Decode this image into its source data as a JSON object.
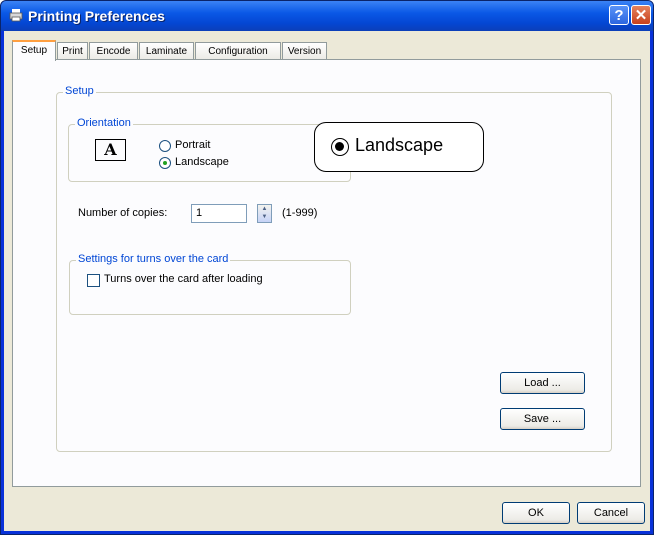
{
  "window": {
    "title": "Printing Preferences",
    "help_symbol": "?",
    "close_symbol": "✕"
  },
  "tabs": [
    {
      "label": "Setup",
      "active": true
    },
    {
      "label": "Print"
    },
    {
      "label": "Encode"
    },
    {
      "label": "Laminate"
    },
    {
      "label": "Configuration"
    },
    {
      "label": "Version"
    }
  ],
  "setup": {
    "group_label": "Setup",
    "orientation": {
      "group_label": "Orientation",
      "icon_glyph": "A",
      "portrait_label": "Portrait",
      "landscape_label": "Landscape",
      "selected": "Landscape"
    },
    "callout": {
      "label": "Landscape"
    },
    "copies": {
      "label": "Number of copies:",
      "value": "1",
      "range": "(1-999)"
    },
    "turn_over": {
      "group_label": "Settings for turns over the card",
      "checkbox_label": "Turns over the card after loading",
      "checked": false
    },
    "load_button": "Load ...",
    "save_button": "Save ..."
  },
  "footer": {
    "ok_button": "OK",
    "cancel_button": "Cancel"
  },
  "colors": {
    "title_bar": "#0a58e6",
    "group_label": "#0046d5",
    "face": "#ece9d8"
  }
}
